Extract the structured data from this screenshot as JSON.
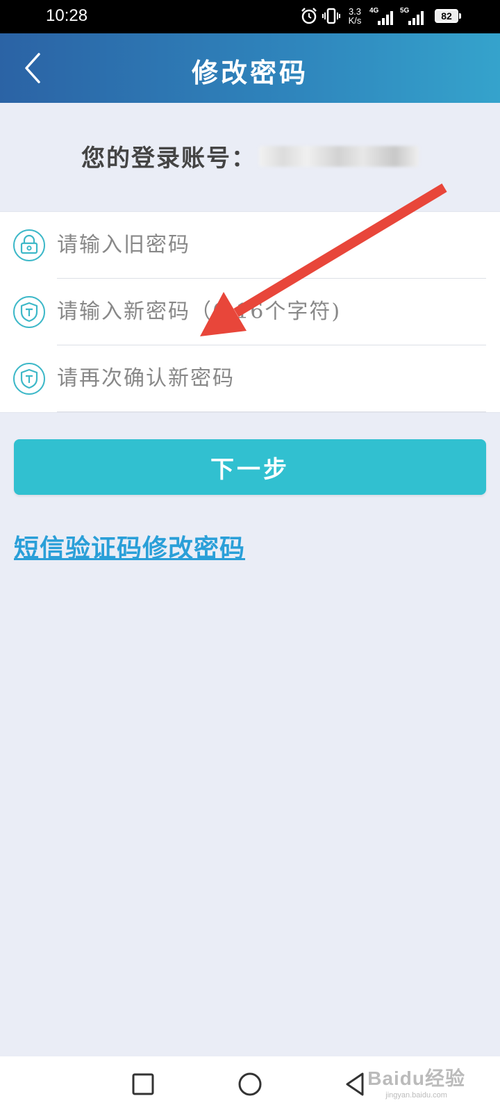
{
  "status_bar": {
    "time": "10:28",
    "net_speed_value": "3.3",
    "net_speed_unit": "K/s",
    "network_1": "4G",
    "network_2": "5G",
    "battery": "82"
  },
  "header": {
    "title": "修改密码"
  },
  "account": {
    "label": "您的登录账号："
  },
  "form": {
    "old_password_placeholder": "请输入旧密码",
    "new_password_placeholder": "请输入新密码（6-16个字符)",
    "confirm_password_placeholder": "请再次确认新密码"
  },
  "actions": {
    "next_label": "下一步",
    "sms_link_label": "短信验证码修改密码"
  },
  "watermark": {
    "brand": "Baidu经验",
    "url": "jingyan.baidu.com"
  },
  "colors": {
    "header_gradient_start": "#2b63a5",
    "header_gradient_end": "#35a3cc",
    "primary_button": "#31c0d0",
    "link": "#2a9fd8",
    "page_background": "#eaedf6",
    "annotation_arrow": "#e8463a"
  },
  "icons": {
    "back": "chevron-left-icon",
    "old_password": "lock-icon",
    "new_password": "shield-t-icon",
    "confirm_password": "shield-t-icon",
    "nav_recents": "square-icon",
    "nav_home": "circle-icon",
    "nav_back": "triangle-back-icon"
  }
}
